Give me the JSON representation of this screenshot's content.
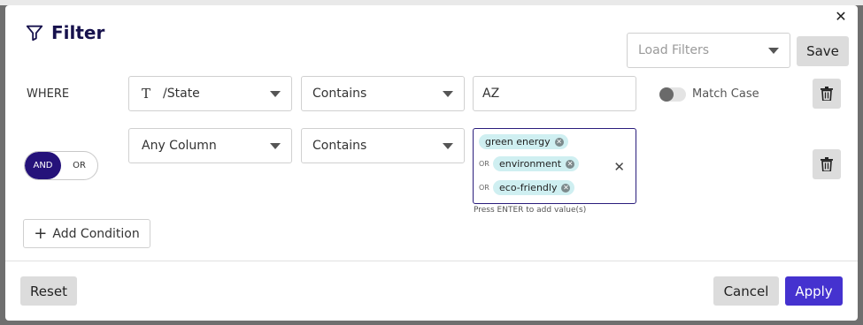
{
  "dialog": {
    "title": "Filter",
    "close_icon": "close-icon",
    "filter_icon": "filter-icon"
  },
  "load_filters": {
    "placeholder": "Load Filters"
  },
  "save_label": "Save",
  "conditions": [
    {
      "prefix": "WHERE",
      "column_icon": "text-type-icon",
      "column_type_glyph": "T",
      "column": "/State",
      "operator": "Contains",
      "value": "AZ",
      "match_case_label": "Match Case",
      "match_case_on": false
    },
    {
      "logic_options": [
        "AND",
        "OR"
      ],
      "logic_selected": "AND",
      "column": "Any Column",
      "operator": "Contains",
      "values": [
        {
          "joiner": "",
          "text": "green energy"
        },
        {
          "joiner": "OR",
          "text": "environment"
        },
        {
          "joiner": "OR",
          "text": "eco-friendly"
        }
      ],
      "hint": "Press ENTER to add value(s)"
    }
  ],
  "add_condition_label": "Add Condition",
  "footer": {
    "reset_label": "Reset",
    "cancel_label": "Cancel",
    "apply_label": "Apply"
  },
  "colors": {
    "accent": "#4532cf",
    "logic_active": "#25127a",
    "tag_bg": "#cfeff1",
    "title": "#17124d"
  }
}
